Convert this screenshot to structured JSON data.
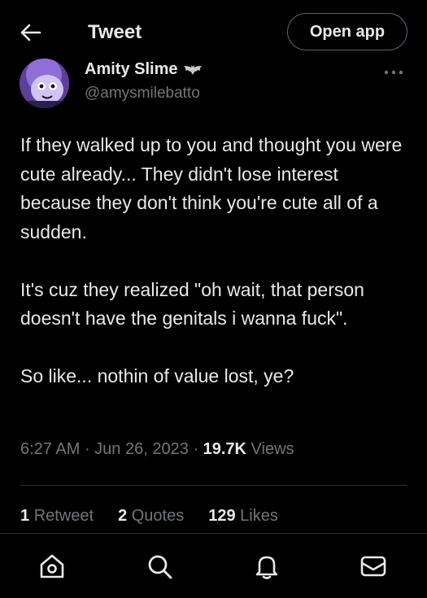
{
  "header": {
    "title": "Tweet",
    "open_app_label": "Open app"
  },
  "author": {
    "name": "Amity Slime",
    "handle": "@amysmilebatto"
  },
  "tweet": {
    "paragraphs": [
      "If they walked up to you and thought you were cute already... They didn't lose interest because they don't think you're cute all of a sudden.",
      "It's cuz they realized \"oh wait, that person doesn't have the genitals i wanna fuck\".",
      "So like... nothin of value lost, ye?"
    ],
    "time": "6:27 AM",
    "date": "Jun 26, 2023",
    "views_count": "19.7K",
    "views_label": "Views"
  },
  "stats": {
    "retweets_count": "1",
    "retweets_label": "Retweet",
    "quotes_count": "2",
    "quotes_label": "Quotes",
    "likes_count": "129",
    "likes_label": "Likes"
  },
  "icons": {
    "back": "arrow-left-icon",
    "more": "more-horizontal-icon",
    "home": "home-icon",
    "search": "search-icon",
    "notifications": "bell-icon",
    "messages": "mail-icon"
  },
  "colors": {
    "background": "#000000",
    "text_primary": "#e7e9ea",
    "text_secondary": "#71767b",
    "divider": "#2f3336"
  }
}
